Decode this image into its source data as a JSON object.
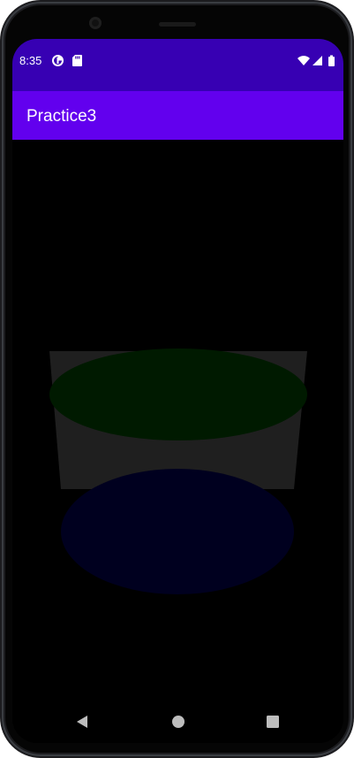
{
  "status_bar": {
    "time": "8:35",
    "background": "#3700b3",
    "left_icons": [
      "data-saver-icon",
      "sd-card-icon"
    ],
    "right_icons": [
      "wifi-icon",
      "cell-signal-icon",
      "battery-icon"
    ]
  },
  "app_bar": {
    "title": "Practice3",
    "background": "#6200ee"
  },
  "scene": {
    "background": "#000000",
    "object": "cylinder",
    "colors": {
      "top_face": "#001a00",
      "side_face": "#1f1f1f",
      "bottom_face": "#00001f"
    }
  },
  "nav_bar": {
    "buttons": [
      "back-icon",
      "home-icon",
      "recents-icon"
    ]
  }
}
